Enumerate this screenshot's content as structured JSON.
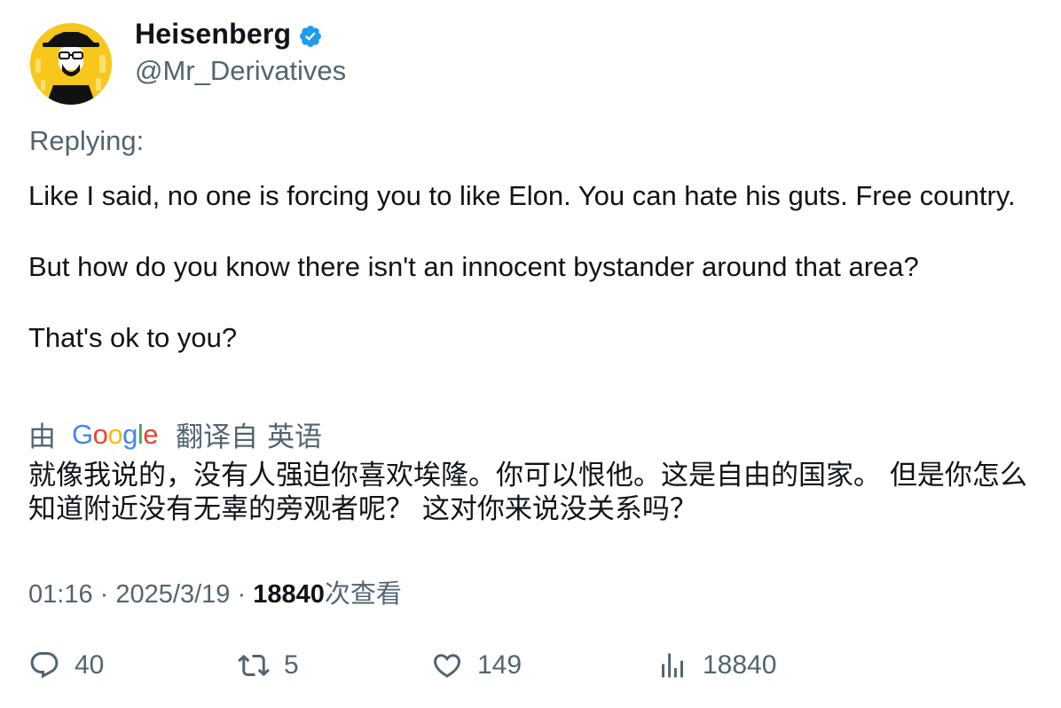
{
  "author": {
    "name": "Heisenberg",
    "handle": "@Mr_Derivatives",
    "verified_icon": "verified-badge-icon",
    "avatar_icon": "heisenberg-avatar-icon"
  },
  "replying_label": "Replying:",
  "tweet_text": "Like I said, no one is forcing you to like Elon. You can hate his guts. Free country.\n\nBut how do you know there isn't an innocent bystander around that area?\n\nThat's ok to you?",
  "translation": {
    "by": "由",
    "google_letters": [
      {
        "ch": "G",
        "color": "#4285F4"
      },
      {
        "ch": "o",
        "color": "#EA4335"
      },
      {
        "ch": "o",
        "color": "#FBBC05"
      },
      {
        "ch": "g",
        "color": "#4285F4"
      },
      {
        "ch": "l",
        "color": "#34A853"
      },
      {
        "ch": "e",
        "color": "#EA4335"
      }
    ],
    "translated_from": "翻译自",
    "language": "英语",
    "text": "就像我说的，没有人强迫你喜欢埃隆。你可以恨他。这是自由的国家。 但是你怎么知道附近没有无辜的旁观者呢？ 这对你来说没关系吗？"
  },
  "meta": {
    "time": "01:16",
    "separator": "·",
    "date": "2025/3/19",
    "views_count": "18840",
    "views_label": "次查看"
  },
  "actions": {
    "replies": "40",
    "retweets": "5",
    "likes": "149",
    "views": "18840"
  },
  "colors": {
    "text_primary": "#0f1419",
    "text_secondary": "#536471",
    "verified_blue": "#1d9bf0",
    "avatar_yellow": "#f7c71b"
  }
}
